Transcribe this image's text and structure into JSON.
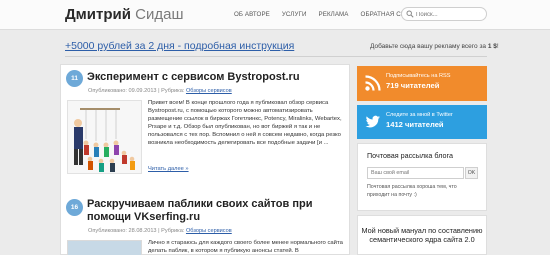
{
  "header": {
    "logo_first": "Дмитрий",
    "logo_last": "Сидаш",
    "nav": [
      "ОБ АВТОРЕ",
      "УСЛУГИ",
      "РЕКЛАМА",
      "ОБРАТНАЯ СВЯЗЬ"
    ],
    "search_placeholder": "Поиск..."
  },
  "promo": {
    "link": "+5000 рублей за 2 дня - подробная инструкция",
    "advert_text": "Добавьте сюда вашу рекламу всего за",
    "advert_price": "1 $",
    "advert_end": "!"
  },
  "posts": [
    {
      "comments": "11",
      "title": "Эксперимент с сервисом Bystropost.ru",
      "published_label": "Опубликовано:",
      "date": "09.09.2013",
      "category_label": "| Рубрика:",
      "category": "Обзоры сервисов",
      "excerpt": "Привет всем! В конце прошлого года я публиковал обзор сервиса Bystropost.ru, с помощью которого можно автоматизировать размещение ссылок в биржах Гогетлинкс, Potency, Miralinks, Webartex, Prsape и т.д. Обзор был опубликован, но вот биржей я так и не пользовался с тех пор. Вспомнил о ней я совсем недавно, когда резко возникла необходимость делегировать все подобные задачи [и ...",
      "read_more": "Читать далее »"
    },
    {
      "comments": "16",
      "title": "Раскручиваем паблики своих сайтов при помощи VKserfing.ru",
      "published_label": "Опубликовано:",
      "date": "28.08.2013",
      "category_label": "| Рубрика:",
      "category": "Обзоры сервисов",
      "excerpt": "Лично я стараюсь для каждого своего более менее нормального сайта делать паблик, в котором я публикую анонсы статей. В"
    }
  ],
  "sidebar": {
    "rss_line1": "Подписывайтесь на RSS",
    "rss_line2": "719 читателей",
    "twitter_line1": "Следите за мной в Twitter",
    "twitter_line2": "1412 читателей",
    "mail_title": "Почтовая рассылка блога",
    "mail_placeholder": "Ваш свой email",
    "mail_button": "OK",
    "mail_note": "Почтовая рассылка хороша тем, что приходит на почту :)",
    "manual_text": "Мой новый мануал по составлению семантического ядра сайта 2.0"
  },
  "colors": {
    "rss": "#f18b2c",
    "twitter": "#2d9fe0",
    "link": "#2d5ea8",
    "badge": "#6ea9d8"
  }
}
